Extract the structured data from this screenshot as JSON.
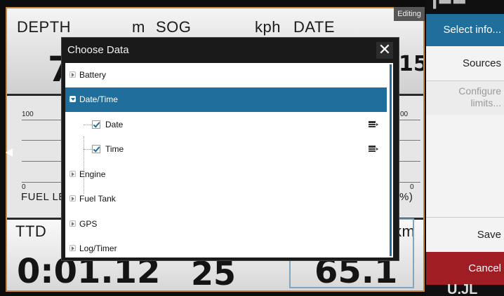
{
  "background": {
    "row1": {
      "depth_label": "DEPTH",
      "depth_unit": "m",
      "sog_label": "SOG",
      "sog_unit": "kph",
      "date_label": "DATE",
      "depth_value_partial": "7",
      "date_value_partial": "15"
    },
    "row2": {
      "left_top_tick": "100",
      "left_bottom_tick": "0",
      "left_label": "FUEL LEV",
      "right_top_tick": "00",
      "right_bottom_tick": "0",
      "right_label": "%)"
    },
    "row3": {
      "ttd_label": "TTD",
      "km_unit": "km",
      "ttd_value": "0:01.12",
      "mid_value": "25",
      "right_value": "65.1"
    },
    "editing_badge": "Editing"
  },
  "sidebar": {
    "top_partial": "▌▀▀ ▀▀",
    "header": "Select info...",
    "sources": "Sources",
    "configure_line1": "Configure",
    "configure_line2": "limits...",
    "save": "Save",
    "cancel": "Cancel",
    "bottom_partial": "U.JL"
  },
  "dialog": {
    "title": "Choose Data",
    "close_glyph": "✕",
    "items": [
      {
        "label": "Battery",
        "state": "collapsed"
      },
      {
        "label": "Date/Time",
        "state": "expanded",
        "selected": true
      },
      {
        "label": "Date",
        "checked": true,
        "child": true
      },
      {
        "label": "Time",
        "checked": true,
        "child": true
      },
      {
        "label": "Engine",
        "state": "collapsed"
      },
      {
        "label": "Fuel Tank",
        "state": "collapsed"
      },
      {
        "label": "GPS",
        "state": "collapsed"
      },
      {
        "label": "Log/Timer",
        "state": "collapsed"
      }
    ]
  },
  "colors": {
    "accent": "#1f6e9c",
    "cancel": "#a11d24",
    "frame": "#c58a3c"
  }
}
